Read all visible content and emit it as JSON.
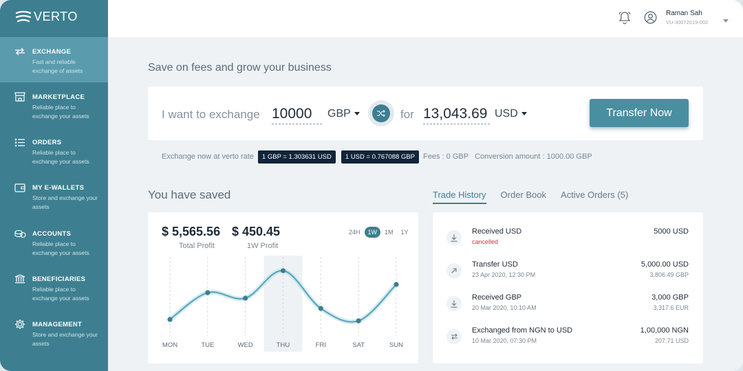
{
  "brand": {
    "name": "VERTO"
  },
  "sidebar": {
    "items": [
      {
        "title": "EXCHANGE",
        "subtitle": "Fast and reliable exchange of assets",
        "icon": "exchange-arrows-icon",
        "active": true
      },
      {
        "title": "MARKETPLACE",
        "subtitle": "Reliable place to exchange your assets",
        "icon": "store-icon",
        "active": false
      },
      {
        "title": "ORDERS",
        "subtitle": "Reliable place to exchange your assets",
        "icon": "list-icon",
        "active": false
      },
      {
        "title": "MY E-WALLETS",
        "subtitle": "Store and exchange your assets",
        "icon": "wallet-icon",
        "active": false
      },
      {
        "title": "ACCOUNTS",
        "subtitle": "Reliable place to exchange your assets",
        "icon": "coins-icon",
        "active": false
      },
      {
        "title": "BENEFICIARIES",
        "subtitle": "Reliable place to exchange your assets",
        "icon": "bank-icon",
        "active": false
      },
      {
        "title": "MANAGEMENT",
        "subtitle": "Store and exchange your assets",
        "icon": "gear-icon",
        "active": false
      }
    ]
  },
  "user": {
    "name": "Raman Sah",
    "id": "VU-30072019-002"
  },
  "main": {
    "headline": "Save on fees and grow your business",
    "exchange": {
      "label": "I want to exchange",
      "amount": "10000",
      "from_currency": "GBP",
      "for_label": "for",
      "result": "13,043.69",
      "to_currency": "USD",
      "button": "Transfer Now"
    },
    "rates": {
      "intro": "Exchange now at verto rate",
      "rate1": "1 GBP = 1.303631 USD",
      "rate2": "1 USD = 0.767088 GBP",
      "fees": "Fees : 0 GBP",
      "conversion": "Conversion amount : 1000.00 GBP"
    }
  },
  "saved": {
    "title": "You have saved",
    "total_profit_value": "$ 5,565.56",
    "total_profit_label": "Total Profit",
    "week_profit_value": "$ 450.45",
    "week_profit_label": "1W Profit",
    "periods": [
      "24H",
      "1W",
      "1M",
      "1Y"
    ],
    "active_period": "1W"
  },
  "chart_data": {
    "type": "line",
    "categories": [
      "MON",
      "TUE",
      "WED",
      "THU",
      "FRI",
      "SAT",
      "SUN"
    ],
    "values": [
      24,
      63,
      55,
      95,
      40,
      22,
      75
    ],
    "ylim": [
      0,
      110
    ],
    "highlighted_category": "THU",
    "grid": "vertical-dashed",
    "accent": "#5aa8bd"
  },
  "trades": {
    "tabs": [
      "Trade History",
      "Order Book",
      "Active Orders (5)"
    ],
    "active_tab": "Trade History",
    "items": [
      {
        "title": "Received USD",
        "sub": "cancelled",
        "sub_status": "cancelled",
        "amount": "5000 USD",
        "amount2": "",
        "icon": "download-icon"
      },
      {
        "title": "Transfer USD",
        "sub": "23 Apr 2020, 12:30 PM",
        "sub_status": "",
        "amount": "5,000.00 USD",
        "amount2": "3,806.49 GBP",
        "icon": "arrow-up-right-icon"
      },
      {
        "title": "Received GBP",
        "sub": "20 Mar 2020, 10:10 AM",
        "sub_status": "",
        "amount": "3,000 GBP",
        "amount2": "3,317.6 EUR",
        "icon": "download-icon"
      },
      {
        "title": "Exchanged from NGN to USD",
        "sub": "10 Mar 2020, 07:30 PM",
        "sub_status": "",
        "amount": "1,00,000 NGN",
        "amount2": "207.71 USD",
        "icon": "exchange-arrows-icon"
      }
    ]
  },
  "colors": {
    "sidebar": "#3d7f90",
    "sidebar_active": "#5b9bae",
    "accent": "#3d7f90",
    "badge": "#10243a",
    "cancelled": "#d0343d"
  }
}
